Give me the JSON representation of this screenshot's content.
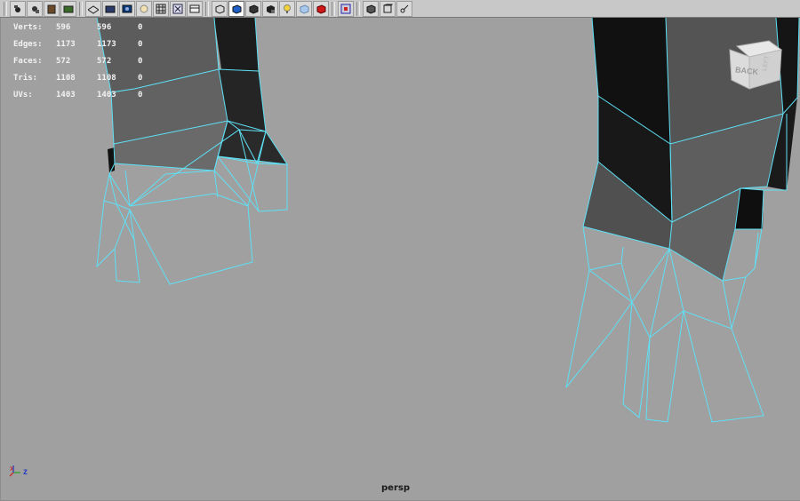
{
  "toolbar": {
    "groups": [
      [
        {
          "name": "camera-select-icon"
        },
        {
          "name": "camera-lock-icon"
        },
        {
          "name": "bookmark-icon"
        },
        {
          "name": "image-plane-icon"
        }
      ],
      [
        {
          "name": "grid-toggle-icon"
        },
        {
          "name": "film-gate-icon"
        },
        {
          "name": "resolution-gate-icon"
        },
        {
          "name": "gate-mask-icon"
        },
        {
          "name": "field-chart-icon"
        },
        {
          "name": "safe-action-icon"
        },
        {
          "name": "safe-title-icon"
        }
      ],
      [
        {
          "name": "wireframe-icon"
        },
        {
          "name": "smooth-shade-icon",
          "active": true
        },
        {
          "name": "flat-shade-icon"
        },
        {
          "name": "shadows-icon"
        },
        {
          "name": "lights-icon"
        },
        {
          "name": "xray-icon"
        },
        {
          "name": "textured-icon"
        }
      ],
      [
        {
          "name": "isolate-select-icon"
        }
      ],
      [
        {
          "name": "wireframe-on-shaded-icon"
        },
        {
          "name": "bounding-box-icon"
        },
        {
          "name": "joint-xray-icon"
        }
      ]
    ]
  },
  "hud": {
    "rows": [
      {
        "label": "Verts:",
        "v1": "596",
        "v2": "596",
        "v3": "0"
      },
      {
        "label": "Edges:",
        "v1": "1173",
        "v2": "1173",
        "v3": "0"
      },
      {
        "label": "Faces:",
        "v1": "572",
        "v2": "572",
        "v3": "0"
      },
      {
        "label": "Tris:",
        "v1": "1108",
        "v2": "1108",
        "v3": "0"
      },
      {
        "label": "UVs:",
        "v1": "1403",
        "v2": "1403",
        "v3": "0"
      }
    ]
  },
  "viewcube": {
    "face_label": "BACK",
    "side_label": "LEFT"
  },
  "view_name": "persp",
  "axis": {
    "x": "x",
    "z": "z"
  },
  "colors": {
    "wire": "#5ee0f5",
    "background": "#a0a0a0",
    "toolbar": "#c8c8c8",
    "hud_text": "#f2f2f2"
  }
}
